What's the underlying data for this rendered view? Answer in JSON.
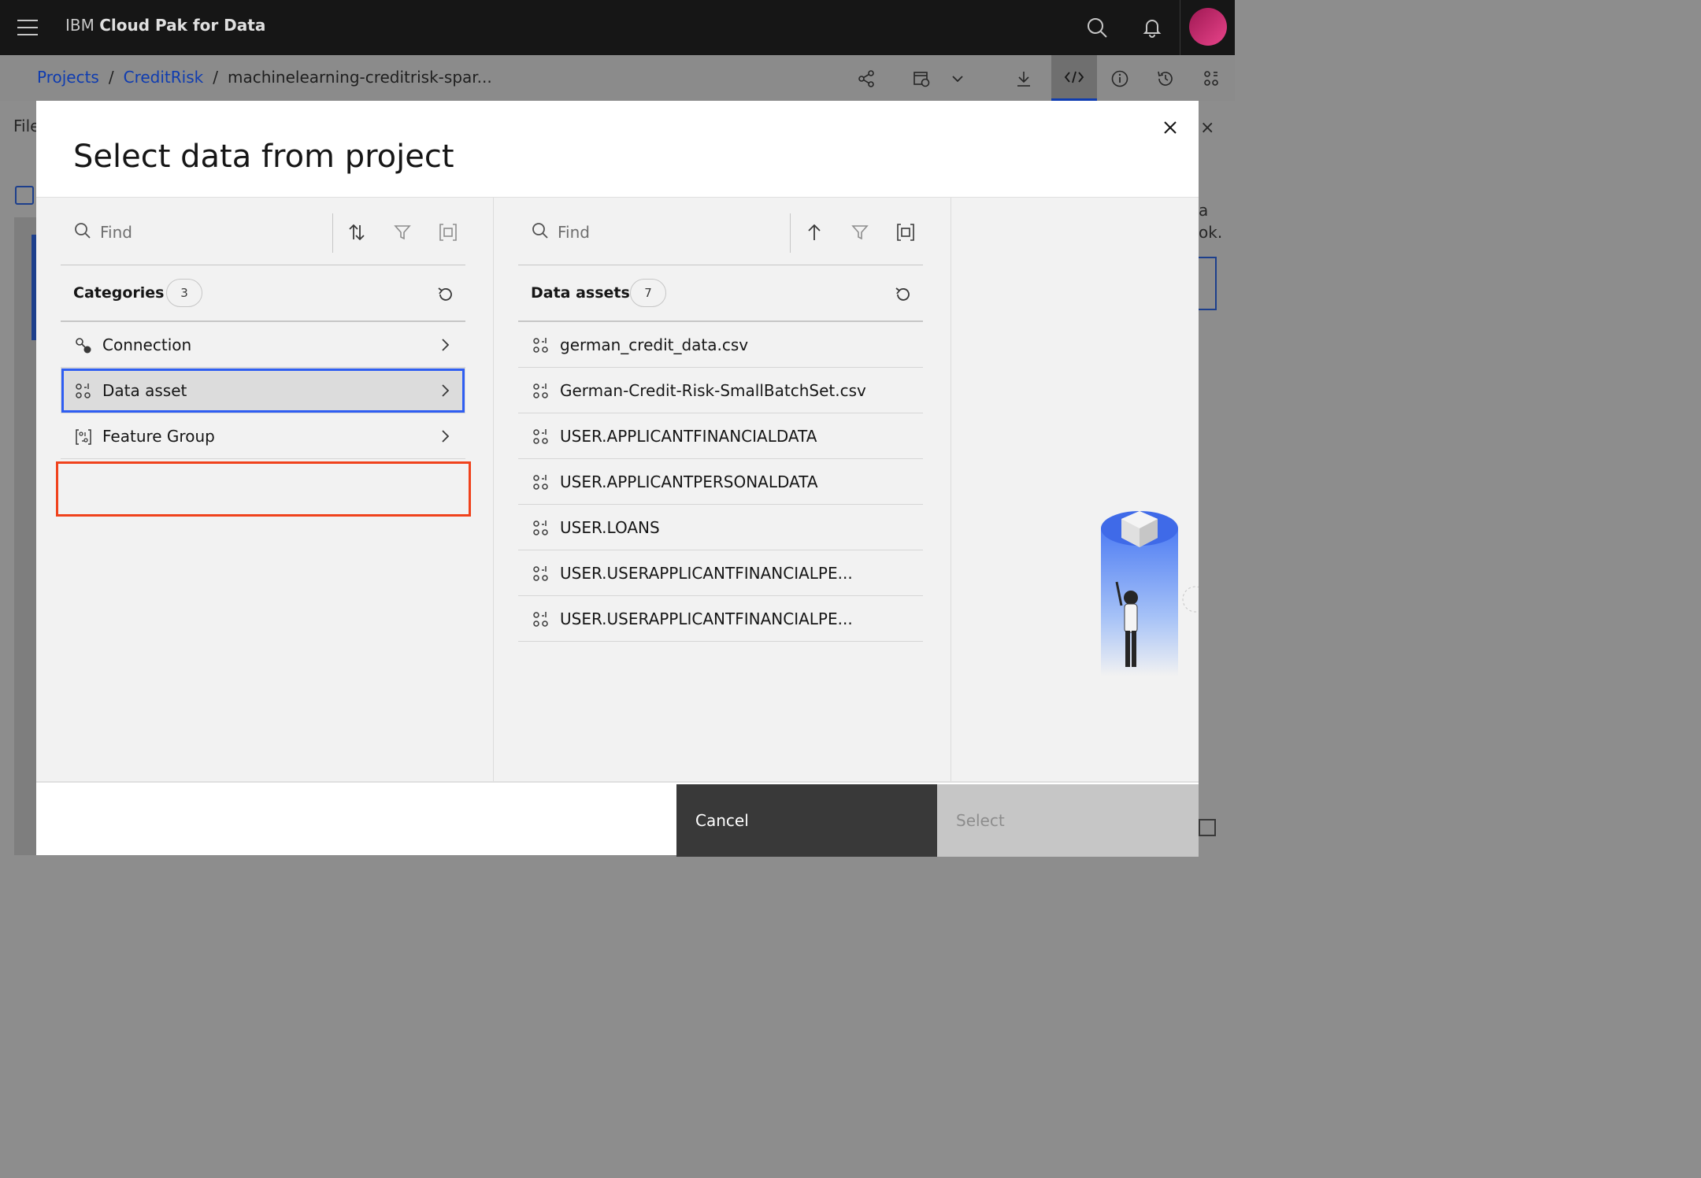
{
  "header": {
    "brand_prefix": "IBM",
    "brand_name": "Cloud Pak for Data"
  },
  "breadcrumb": {
    "items": [
      "Projects",
      "CreditRisk",
      "machinelearning-creditrisk-spar..."
    ],
    "separator": "/"
  },
  "background": {
    "file_label": "File",
    "side_text_line1": "a",
    "side_text_line2": "ok."
  },
  "modal": {
    "title": "Select data from project",
    "left_pane": {
      "search_placeholder": "Find",
      "section_title": "Categories",
      "count": "3",
      "items": [
        {
          "label": "Connection",
          "icon": "connection-icon"
        },
        {
          "label": "Data asset",
          "icon": "data-asset-icon",
          "selected": true
        },
        {
          "label": "Feature Group",
          "icon": "feature-group-icon"
        }
      ]
    },
    "right_pane": {
      "search_placeholder": "Find",
      "section_title": "Data assets",
      "count": "7",
      "items": [
        "german_credit_data.csv",
        "German-Credit-Risk-SmallBatchSet.csv",
        "USER.APPLICANTFINANCIALDATA",
        "USER.APPLICANTPERSONALDATA",
        "USER.LOANS",
        "USER.USERAPPLICANTFINANCIALPE...",
        "USER.USERAPPLICANTFINANCIALPE..."
      ]
    },
    "footer": {
      "cancel_label": "Cancel",
      "select_label": "Select"
    }
  },
  "colors": {
    "topbar": "#161616",
    "link": "#0f3cb0",
    "selection_outline": "#2f5ef2",
    "highlight_annotation": "#f0421c",
    "cancel_button": "#393939",
    "select_button_disabled": "#c6c6c6"
  }
}
